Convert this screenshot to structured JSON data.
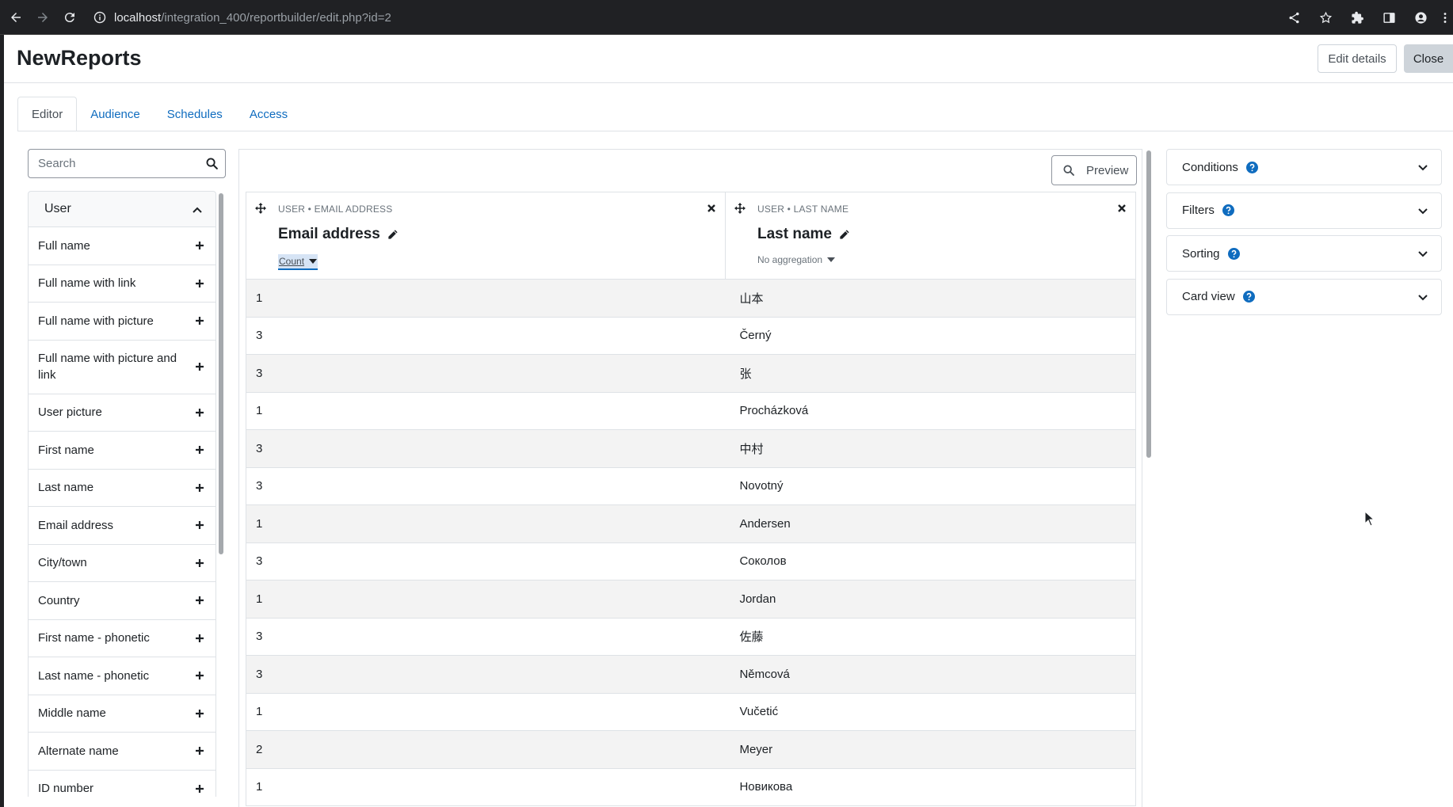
{
  "browser": {
    "url_host": "localhost",
    "url_path": "/integration_400/reportbuilder/edit.php?id=2"
  },
  "header": {
    "title": "NewReports",
    "edit_details_label": "Edit details",
    "close_label": "Close"
  },
  "tabs": [
    {
      "label": "Editor",
      "active": true
    },
    {
      "label": "Audience",
      "active": false
    },
    {
      "label": "Schedules",
      "active": false
    },
    {
      "label": "Access",
      "active": false
    }
  ],
  "sidebar": {
    "search_placeholder": "Search",
    "category": "User",
    "fields": [
      "Full name",
      "Full name with link",
      "Full name with picture",
      "Full name with picture and link",
      "User picture",
      "First name",
      "Last name",
      "Email address",
      "City/town",
      "Country",
      "First name - phonetic",
      "Last name - phonetic",
      "Middle name",
      "Alternate name",
      "ID number"
    ]
  },
  "main": {
    "preview_label": "Preview",
    "columns": [
      {
        "sub": "USER • EMAIL ADDRESS",
        "name": "Email address",
        "aggregation": "Count"
      },
      {
        "sub": "USER • LAST NAME",
        "name": "Last name",
        "aggregation": "No aggregation"
      }
    ],
    "rows": [
      [
        "1",
        "山本"
      ],
      [
        "3",
        "Černý"
      ],
      [
        "3",
        "张"
      ],
      [
        "1",
        "Procházková"
      ],
      [
        "3",
        "中村"
      ],
      [
        "3",
        "Novotný"
      ],
      [
        "1",
        "Andersen"
      ],
      [
        "3",
        "Соколов"
      ],
      [
        "1",
        "Jordan"
      ],
      [
        "3",
        "佐藤"
      ],
      [
        "3",
        "Němcová"
      ],
      [
        "1",
        "Vučetić"
      ],
      [
        "2",
        "Meyer"
      ],
      [
        "1",
        "Новикова"
      ]
    ]
  },
  "right_panel": {
    "cards": [
      "Conditions",
      "Filters",
      "Sorting",
      "Card view"
    ]
  },
  "colors": {
    "link": "#0f6cbf",
    "help_icon": "#0f6cbf",
    "chrome_bg": "#202124"
  }
}
